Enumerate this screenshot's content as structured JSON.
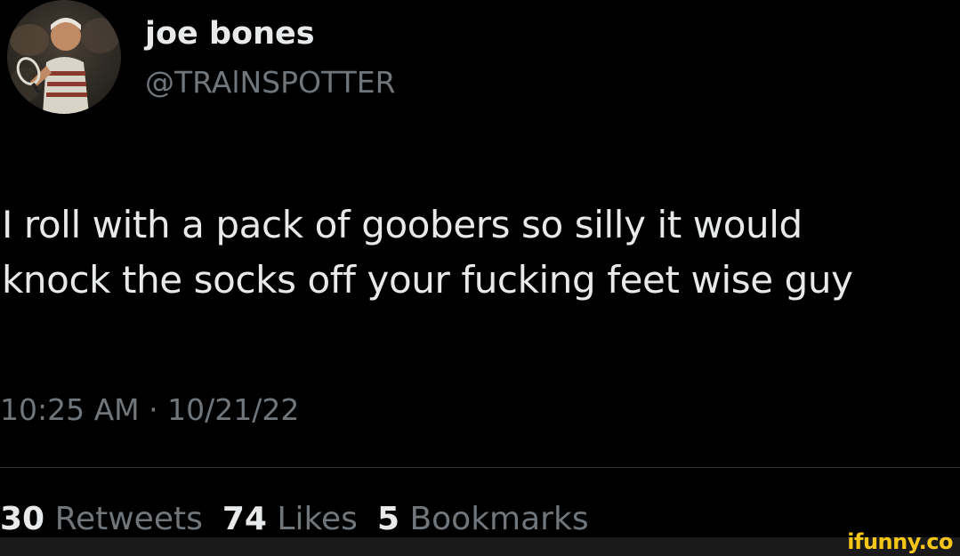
{
  "author": {
    "display_name": "joe bones",
    "handle": "@TRAlNSPOTTER",
    "avatar_icon": "profile-photo-tennis-player"
  },
  "tweet": {
    "lines": [
      "I roll with a pack of goobers so silly it would",
      "knock the socks off your fucking feet wise guy"
    ],
    "timestamp": "10:25 AM · 10/21/22"
  },
  "stats": {
    "retweets_count": "30",
    "retweets_label": "Retweets",
    "likes_count": "74",
    "likes_label": "Likes",
    "bookmarks_count": "5",
    "bookmarks_label": "Bookmarks"
  },
  "watermark": {
    "text": "ifunny.co",
    "color": "#f5c518"
  },
  "colors": {
    "background": "#000000",
    "primary_text": "#e7e9ea",
    "secondary_text": "#71767b",
    "divider": "#2f3336"
  }
}
